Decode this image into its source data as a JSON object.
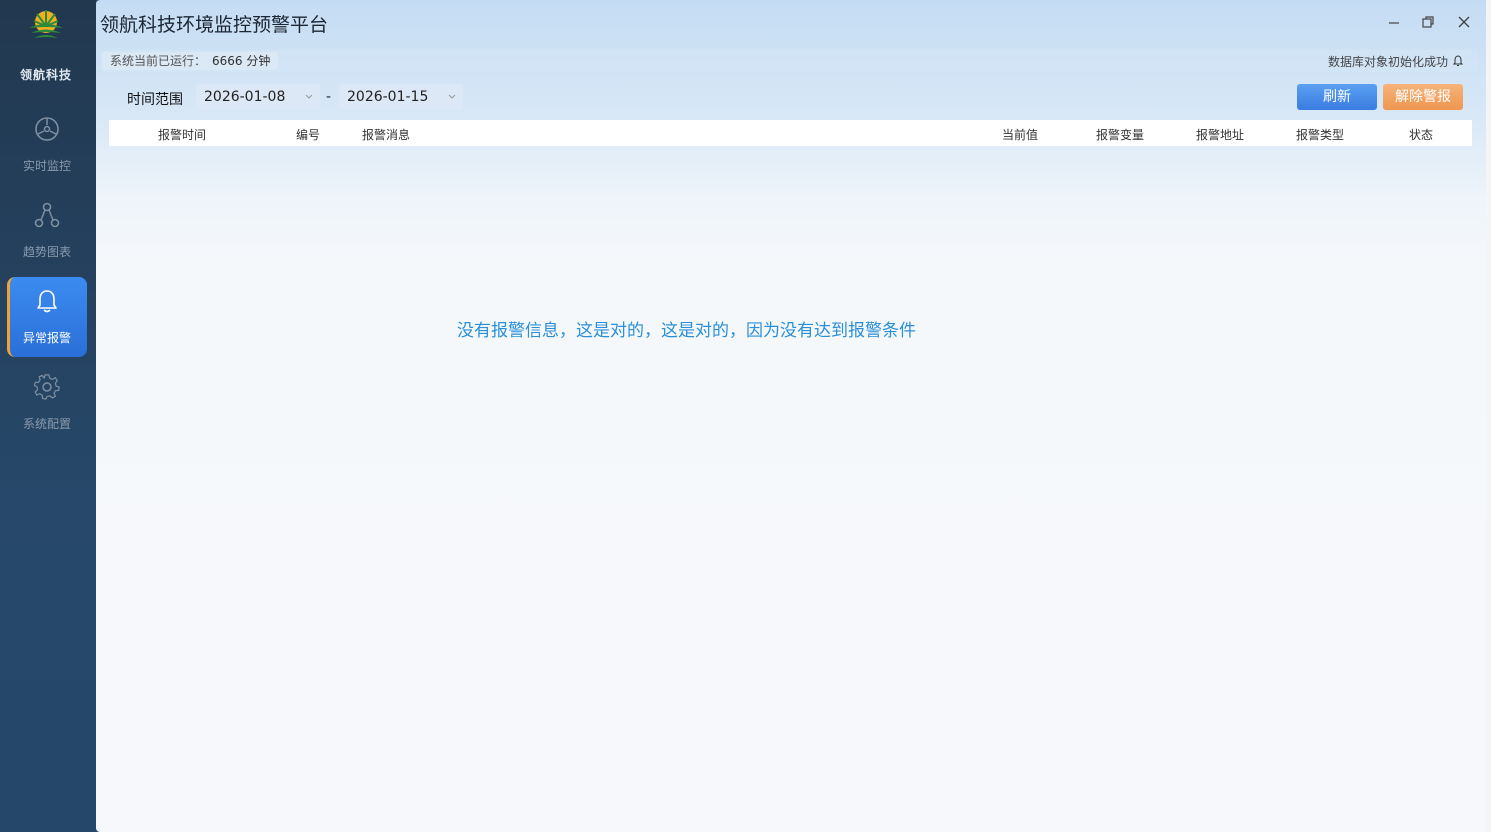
{
  "sidebar": {
    "brand": "领航科技",
    "items": [
      {
        "label": "实时监控",
        "icon": "monitor-icon",
        "active": false
      },
      {
        "label": "趋势图表",
        "icon": "nodes-icon",
        "active": false
      },
      {
        "label": "异常报警",
        "icon": "bell-icon",
        "active": true
      },
      {
        "label": "系统配置",
        "icon": "gear-icon",
        "active": false
      }
    ]
  },
  "window": {
    "title": "领航科技环境监控预警平台",
    "controls": [
      "minimize-icon",
      "restore-icon",
      "close-icon"
    ]
  },
  "status": {
    "run_label": "系统当前已运行：",
    "run_value": "6666 分钟",
    "db_status": "数据库对象初始化成功"
  },
  "filter": {
    "range_label": "时间范围",
    "start_date": "2026-01-08",
    "separator": "-",
    "end_date": "2026-01-15"
  },
  "actions": {
    "refresh": "刷新",
    "clear_alarm": "解除警报"
  },
  "table": {
    "columns": [
      "报警时间",
      "编号",
      "报警消息",
      "当前值",
      "报警变量",
      "报警地址",
      "报警类型",
      "状态"
    ],
    "rows": []
  },
  "empty_message": "没有报警信息，这是对的，这是对的，因为没有达到报警条件",
  "colors": {
    "accent": "#3a7ce0",
    "warning": "#ee9650",
    "empty_text": "#2a8fd8",
    "sidebar_bg": "#27486a"
  }
}
